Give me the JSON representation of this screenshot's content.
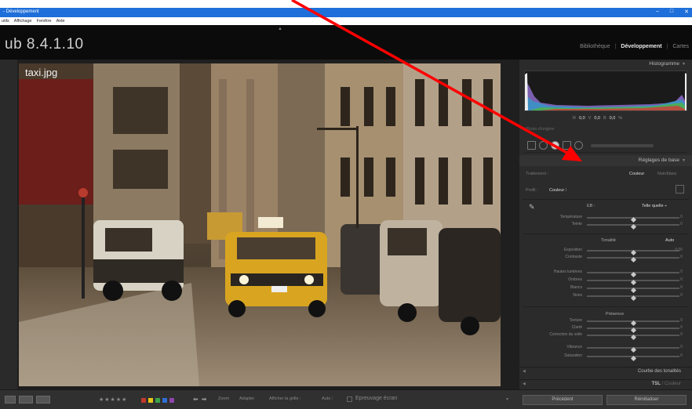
{
  "window": {
    "title": "- Développement",
    "controls": [
      "–",
      "□",
      "✕"
    ]
  },
  "menu": [
    "utils",
    "Affichage",
    "Fenêtre",
    "Aide"
  ],
  "app": {
    "name": "ub 8.4.1.10",
    "modules": [
      "Bibliothèque",
      "Développement",
      "Cartes"
    ],
    "active_module": "Développement"
  },
  "photo": {
    "filename": "taxi.jpg"
  },
  "panel": {
    "histogram_title": "Histogramme",
    "histogram_values": {
      "r_label": "R",
      "r": "0,0",
      "v_label": "V",
      "v": "0,0",
      "b_label": "B",
      "b": "0,0",
      "unit": "%"
    },
    "original": "Photo d'origine",
    "basic_title": "Réglages de base",
    "treatment_label": "Traitement :",
    "treatment_color": "Couleur",
    "treatment_bw": "Noir/blanc",
    "profile_label": "Profil :",
    "profile_value": "Couleur ⁝",
    "wb_label": "EB :",
    "wb_value": "Telle quelle ÷",
    "wb_sliders": [
      {
        "label": "Température",
        "value": "0",
        "pos": 0.5
      },
      {
        "label": "Teinte",
        "value": "0",
        "pos": 0.5
      }
    ],
    "tone_label": "Tonalité",
    "tone_auto": "Auto",
    "tone_sliders": [
      {
        "label": "Exposition",
        "value": "0,00",
        "pos": 0.5
      },
      {
        "label": "Contraste",
        "value": "0",
        "pos": 0.5
      }
    ],
    "light_sliders": [
      {
        "label": "Hautes lumières",
        "value": "0",
        "pos": 0.5
      },
      {
        "label": "Ombres",
        "value": "0",
        "pos": 0.5
      },
      {
        "label": "Blancs",
        "value": "0",
        "pos": 0.5
      },
      {
        "label": "Noirs",
        "value": "0",
        "pos": 0.5
      }
    ],
    "presence_label": "Présence",
    "presence_sliders": [
      {
        "label": "Texture",
        "value": "0",
        "pos": 0.5
      },
      {
        "label": "Clarté",
        "value": "0",
        "pos": 0.5
      },
      {
        "label": "Correction du voile",
        "value": "0",
        "pos": 0.5
      }
    ],
    "saturation_sliders": [
      {
        "label": "Vibrance",
        "value": "0",
        "pos": 0.5
      },
      {
        "label": "Saturation",
        "value": "0",
        "pos": 0.5
      }
    ],
    "curve_title": "Courbe des tonalités",
    "hsl_title": "TSL",
    "hsl_sep": "/",
    "hsl_color": "Couleur"
  },
  "toolbar": {
    "stars": "★★★★★",
    "flag_colors": [
      "#c0392b",
      "#e6c619",
      "#3aa34a",
      "#2f6fd6",
      "#8e44ad"
    ],
    "zoom_label": "Zoom",
    "fit_label": "Adapter",
    "grid_label": "Afficher la grille :",
    "auto_label": "Auto ⁝",
    "softproof_label": "Epreuvage écran",
    "previous_button": "Précédent",
    "reset_button": "Réinitialiser"
  },
  "colors": {
    "accent_arrow": "#ff0000",
    "titlebar": "#1e6fd9"
  }
}
